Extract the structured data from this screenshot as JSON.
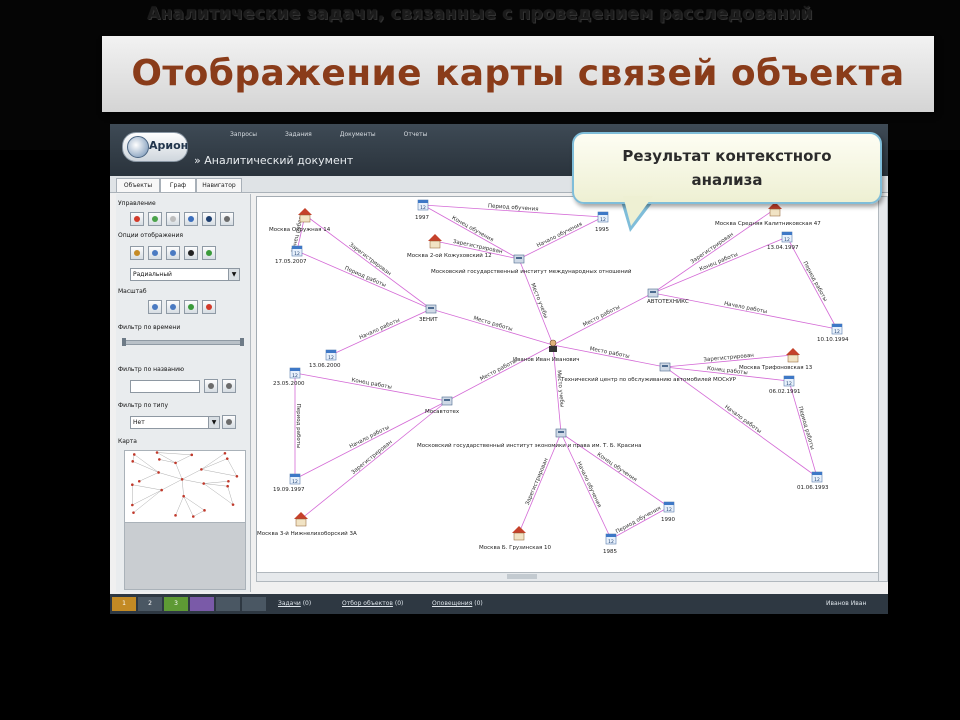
{
  "slide": {
    "heading": "Аналитические задачи, связанные с проведением расследований",
    "title": "Отображение карты связей объекта",
    "callout": [
      "Результат контекстного",
      "анализа"
    ]
  },
  "app": {
    "logo": "Арион",
    "topnav": [
      "Запросы",
      "Задания",
      "Документы",
      "Отчеты"
    ],
    "doc_title": "» Аналитический документ",
    "tabs": [
      "Объекты",
      "Граф",
      "Навигатор"
    ],
    "left_panel": {
      "control_label": "Управление",
      "display_label": "Опции отображения",
      "layout_value": "Радиальный",
      "scale_label": "Масштаб",
      "time_filter_label": "Фильтр по времени",
      "name_filter_label": "Фильтр по названию",
      "type_filter_label": "Фильтр по типу",
      "type_value": "Нет",
      "map_label": "Карта"
    },
    "status_bar": {
      "pages": [
        "1",
        "2",
        "3"
      ],
      "items": [
        {
          "label": "Задачи",
          "count": "(0)"
        },
        {
          "label": "Отбор объектов",
          "count": "(0)"
        },
        {
          "label": "Оповещения",
          "count": "(0)"
        }
      ],
      "user": "Иванов Иван"
    }
  },
  "graph": {
    "nodes": [
      {
        "id": "center",
        "kind": "person",
        "label": "Иванов Иван Иванович"
      },
      {
        "id": "org1",
        "kind": "org",
        "label": "ЗЕНИТ"
      },
      {
        "id": "org2",
        "kind": "org",
        "label": "АВТОТЕХНИКС"
      },
      {
        "id": "org3",
        "kind": "org",
        "label": "Технический центр по обслуживанию автомобилей МОСкУР"
      },
      {
        "id": "org4",
        "kind": "org",
        "label": "Мосавтотех"
      },
      {
        "id": "org5",
        "kind": "org",
        "label": "Московский государственный институт международных отношений"
      },
      {
        "id": "org6",
        "kind": "org",
        "label": "Московский государственный институт экономики и права им. Т. Б. Красина"
      },
      {
        "id": "h1",
        "kind": "house",
        "label": "Москва Окружная 14"
      },
      {
        "id": "h2",
        "kind": "house",
        "label": "Москва 2-ой Кожуховский 12"
      },
      {
        "id": "h3",
        "kind": "house",
        "label": "Москва Средняя Калитниковская 47"
      },
      {
        "id": "h4",
        "kind": "house",
        "label": "Москва Трифоновская 13"
      },
      {
        "id": "h5",
        "kind": "house",
        "label": "Москва 3-й Нижнелихоборский 3А"
      },
      {
        "id": "h6",
        "kind": "house",
        "label": "Москва Б. Грузинская 10"
      },
      {
        "id": "d1",
        "kind": "date",
        "label": "17.05.2007"
      },
      {
        "id": "d2",
        "kind": "date",
        "label": "13.06.2000"
      },
      {
        "id": "d3",
        "kind": "date",
        "label": "23.05.2000"
      },
      {
        "id": "d4",
        "kind": "date",
        "label": "19.09.1997"
      },
      {
        "id": "d5",
        "kind": "date",
        "label": "1997"
      },
      {
        "id": "d6",
        "kind": "date",
        "label": "1995"
      },
      {
        "id": "d7",
        "kind": "date",
        "label": "13.04.1997"
      },
      {
        "id": "d8",
        "kind": "date",
        "label": "10.10.1994"
      },
      {
        "id": "d9",
        "kind": "date",
        "label": "06.02.1991"
      },
      {
        "id": "d10",
        "kind": "date",
        "label": "01.06.1993"
      },
      {
        "id": "d11",
        "kind": "date",
        "label": "1990"
      },
      {
        "id": "d12",
        "kind": "date",
        "label": "1985"
      }
    ],
    "edges": [
      {
        "from": "center",
        "to": "org1",
        "label": "Место работы"
      },
      {
        "from": "center",
        "to": "org2",
        "label": "Место работы"
      },
      {
        "from": "center",
        "to": "org3",
        "label": "Место работы"
      },
      {
        "from": "center",
        "to": "org4",
        "label": "Место работы"
      },
      {
        "from": "center",
        "to": "org5",
        "label": "Место учебы"
      },
      {
        "from": "center",
        "to": "org6",
        "label": "Место учебы"
      },
      {
        "from": "org1",
        "to": "d1",
        "label": "Период работы"
      },
      {
        "from": "org1",
        "to": "d2",
        "label": "Начало работы"
      },
      {
        "from": "org1",
        "to": "h1",
        "label": "Зарегистрирован"
      },
      {
        "from": "h1",
        "to": "d1",
        "label": "Конец работы"
      },
      {
        "from": "org4",
        "to": "d3",
        "label": "Конец работы"
      },
      {
        "from": "org4",
        "to": "d4",
        "label": "Начало работы"
      },
      {
        "from": "org4",
        "to": "h5",
        "label": "Зарегистрирован"
      },
      {
        "from": "d3",
        "to": "d4",
        "label": "Период работы"
      },
      {
        "from": "org5",
        "to": "d5",
        "label": "Конец обучения"
      },
      {
        "from": "org5",
        "to": "d6",
        "label": "Начало обучения"
      },
      {
        "from": "org5",
        "to": "h2",
        "label": "Зарегистрирован"
      },
      {
        "from": "d5",
        "to": "d6",
        "label": "Период обучения"
      },
      {
        "from": "org2",
        "to": "d7",
        "label": "Конец работы"
      },
      {
        "from": "org2",
        "to": "d8",
        "label": "Начало работы"
      },
      {
        "from": "org2",
        "to": "h3",
        "label": "Зарегистрирован"
      },
      {
        "from": "d7",
        "to": "d8",
        "label": "Период работы"
      },
      {
        "from": "org3",
        "to": "d9",
        "label": "Конец работы"
      },
      {
        "from": "org3",
        "to": "d10",
        "label": "Начало работы"
      },
      {
        "from": "org3",
        "to": "h4",
        "label": "Зарегистрирован"
      },
      {
        "from": "d9",
        "to": "d10",
        "label": "Период работы"
      },
      {
        "from": "org6",
        "to": "d11",
        "label": "Конец обучения"
      },
      {
        "from": "org6",
        "to": "d12",
        "label": "Начало обучения"
      },
      {
        "from": "org6",
        "to": "h6",
        "label": "Зарегистрирован"
      },
      {
        "from": "d11",
        "to": "d12",
        "label": "Период обучения"
      }
    ]
  },
  "colors": {
    "edge": "#d46ad6",
    "title": "#8a3c1a",
    "callout_border": "#7fbdd9"
  }
}
